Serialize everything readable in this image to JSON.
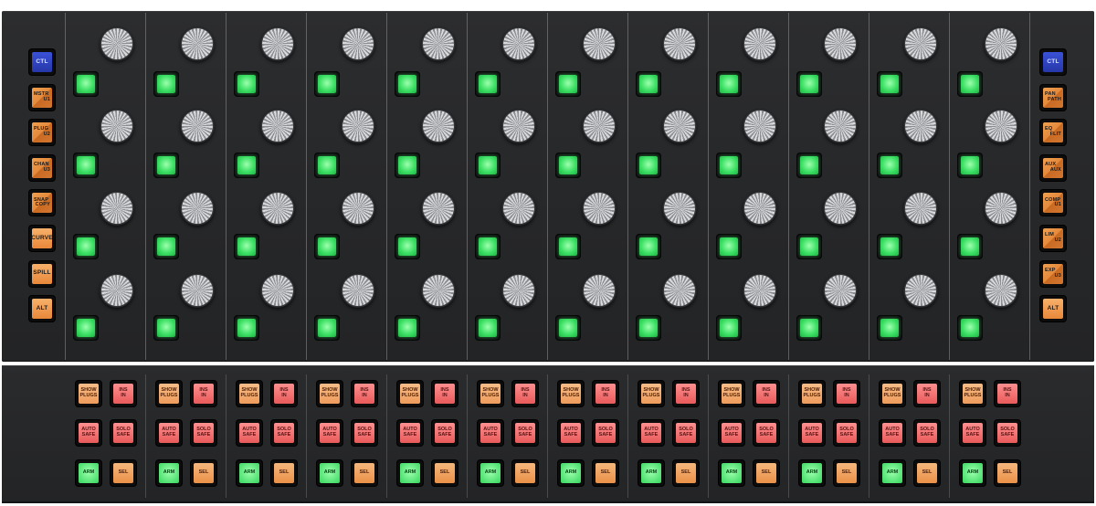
{
  "surface": {
    "strip_count": 12,
    "knobs_per_strip": 4,
    "colors": {
      "deck": "#262729",
      "knob_cap": "#e6e6e6",
      "select_green": "#3de065",
      "softkey_orange": "#e8883a",
      "ctl_blue": "#2637a8",
      "insert_red": "#e85a5a"
    }
  },
  "left_keys": [
    {
      "top": "CTL",
      "bottom": "",
      "style": "blue"
    },
    {
      "top": "MSTR",
      "bottom": "U1",
      "style": "split"
    },
    {
      "top": "PLUG",
      "bottom": "U2",
      "style": "split"
    },
    {
      "top": "CHAN",
      "bottom": "U3",
      "style": "split"
    },
    {
      "top": "SNAP",
      "bottom": "COPY",
      "style": "split"
    },
    {
      "top": "CURVE",
      "bottom": "",
      "style": "orange"
    },
    {
      "top": "SPILL",
      "bottom": "",
      "style": "orange"
    },
    {
      "top": "ALT",
      "bottom": "",
      "style": "orange"
    }
  ],
  "right_keys": [
    {
      "top": "CTL",
      "bottom": "",
      "style": "blue"
    },
    {
      "top": "PAN",
      "bottom": "PATH",
      "style": "split"
    },
    {
      "top": "EQ",
      "bottom": "FLIT",
      "style": "split"
    },
    {
      "top": "AUX",
      "bottom": "AUX",
      "style": "split"
    },
    {
      "top": "COMP",
      "bottom": "U1",
      "style": "split"
    },
    {
      "top": "LIM",
      "bottom": "U2",
      "style": "split"
    },
    {
      "top": "EXP",
      "bottom": "U3",
      "style": "split"
    },
    {
      "top": "ALT",
      "bottom": "",
      "style": "orange"
    }
  ],
  "strip_buttons": {
    "show_plugs": [
      "SHOW",
      "PLUGS"
    ],
    "ins_in": [
      "INS",
      "IN"
    ],
    "auto_safe": [
      "AUTO",
      "SAFE"
    ],
    "solo_safe": [
      "SOLO",
      "SAFE"
    ],
    "arm": "ARM",
    "sel": "SEL"
  }
}
